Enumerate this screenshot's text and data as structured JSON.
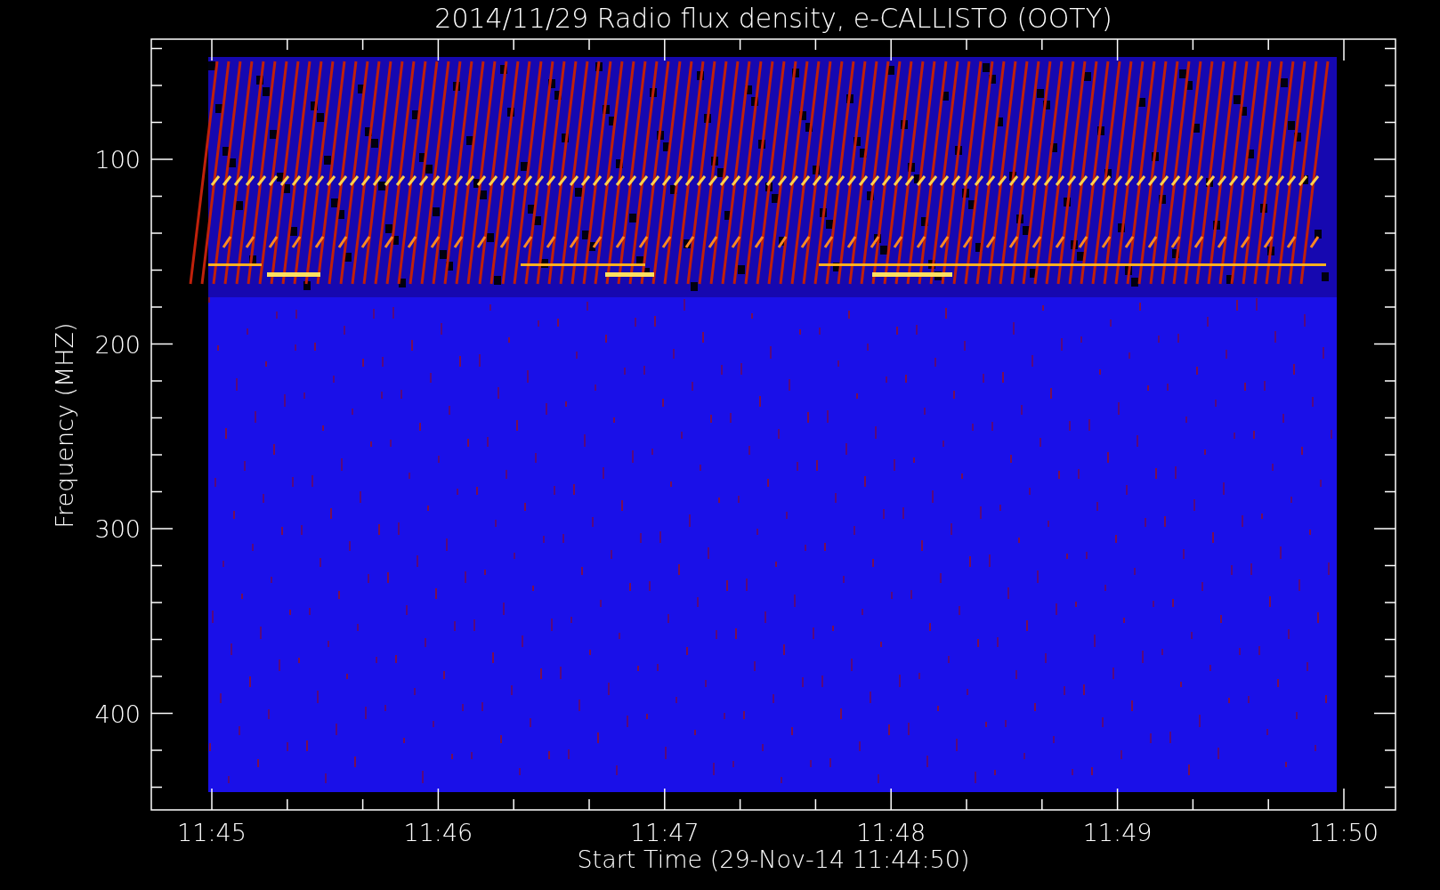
{
  "title": "2014/11/29  Radio flux density, e-CALLISTO (OOTY)",
  "x_axis": {
    "label": "Start Time (29-Nov-14 11:44:50)",
    "ticks": [
      "11:45",
      "11:46",
      "11:47",
      "11:48",
      "11:49",
      "11:50"
    ]
  },
  "y_axis": {
    "label": "Frequency (MHZ)",
    "ticks": [
      "100",
      "200",
      "300",
      "400"
    ]
  }
}
